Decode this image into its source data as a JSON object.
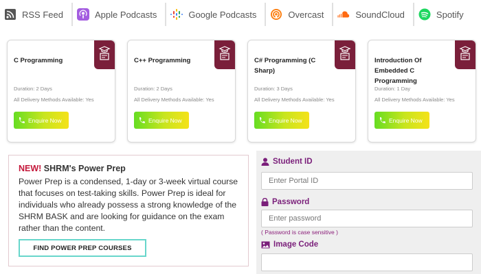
{
  "podcast_nav": [
    {
      "label": "RSS Feed",
      "icon": "rss-icon"
    },
    {
      "label": "Apple Podcasts",
      "icon": "apple-podcasts-icon"
    },
    {
      "label": "Google Podcasts",
      "icon": "google-podcasts-icon"
    },
    {
      "label": "Overcast",
      "icon": "overcast-icon"
    },
    {
      "label": "SoundCloud",
      "icon": "soundcloud-icon"
    },
    {
      "label": "Spotify",
      "icon": "spotify-icon"
    }
  ],
  "courses": [
    {
      "title": "C Programming",
      "duration": "Duration: 2 Days",
      "delivery": "All Delivery Methods Available: Yes",
      "button": "Enquire Now"
    },
    {
      "title": "C++ Programming",
      "duration": "Duration: 2 Days",
      "delivery": "All Delivery Methods Available: Yes",
      "button": "Enquire Now"
    },
    {
      "title": "C# Programming (C Sharp)",
      "duration": "Duration: 3 Days",
      "delivery": "All Delivery Methods Available: Yes",
      "button": "Enquire Now"
    },
    {
      "title": "Introduction Of Embedded C Programming",
      "duration": "Duration: 1 Day",
      "delivery": "All Delivery Methods Available: Yes",
      "button": "Enquire Now"
    }
  ],
  "promo": {
    "new_label": "NEW!",
    "title": " SHRM's Power Prep",
    "body": "Power Prep is a condensed, 1-day or 3-week virtual course that focuses on test-taking skills. Power Prep is ideal for individuals who already possess a strong knowledge of the SHRM BASK and are looking for guidance on the exam rather than the content.",
    "button": "FIND POWER PREP COURSES"
  },
  "login_form": {
    "student_id_label": "Student ID",
    "student_id_placeholder": "Enter Portal ID",
    "password_label": "Password",
    "password_placeholder": "Enter password",
    "password_hint": "( Password is case sensitive )",
    "image_code_label": "Image Code",
    "image_code_placeholder": ""
  },
  "colors": {
    "brand_maroon": "#7a1f3a",
    "form_label_purple": "#7a1f7a",
    "new_red": "#c4173a",
    "button_gradient_start": "#66dd22",
    "button_gradient_end": "#f5e219",
    "promo_button_border": "#67d6cb"
  }
}
